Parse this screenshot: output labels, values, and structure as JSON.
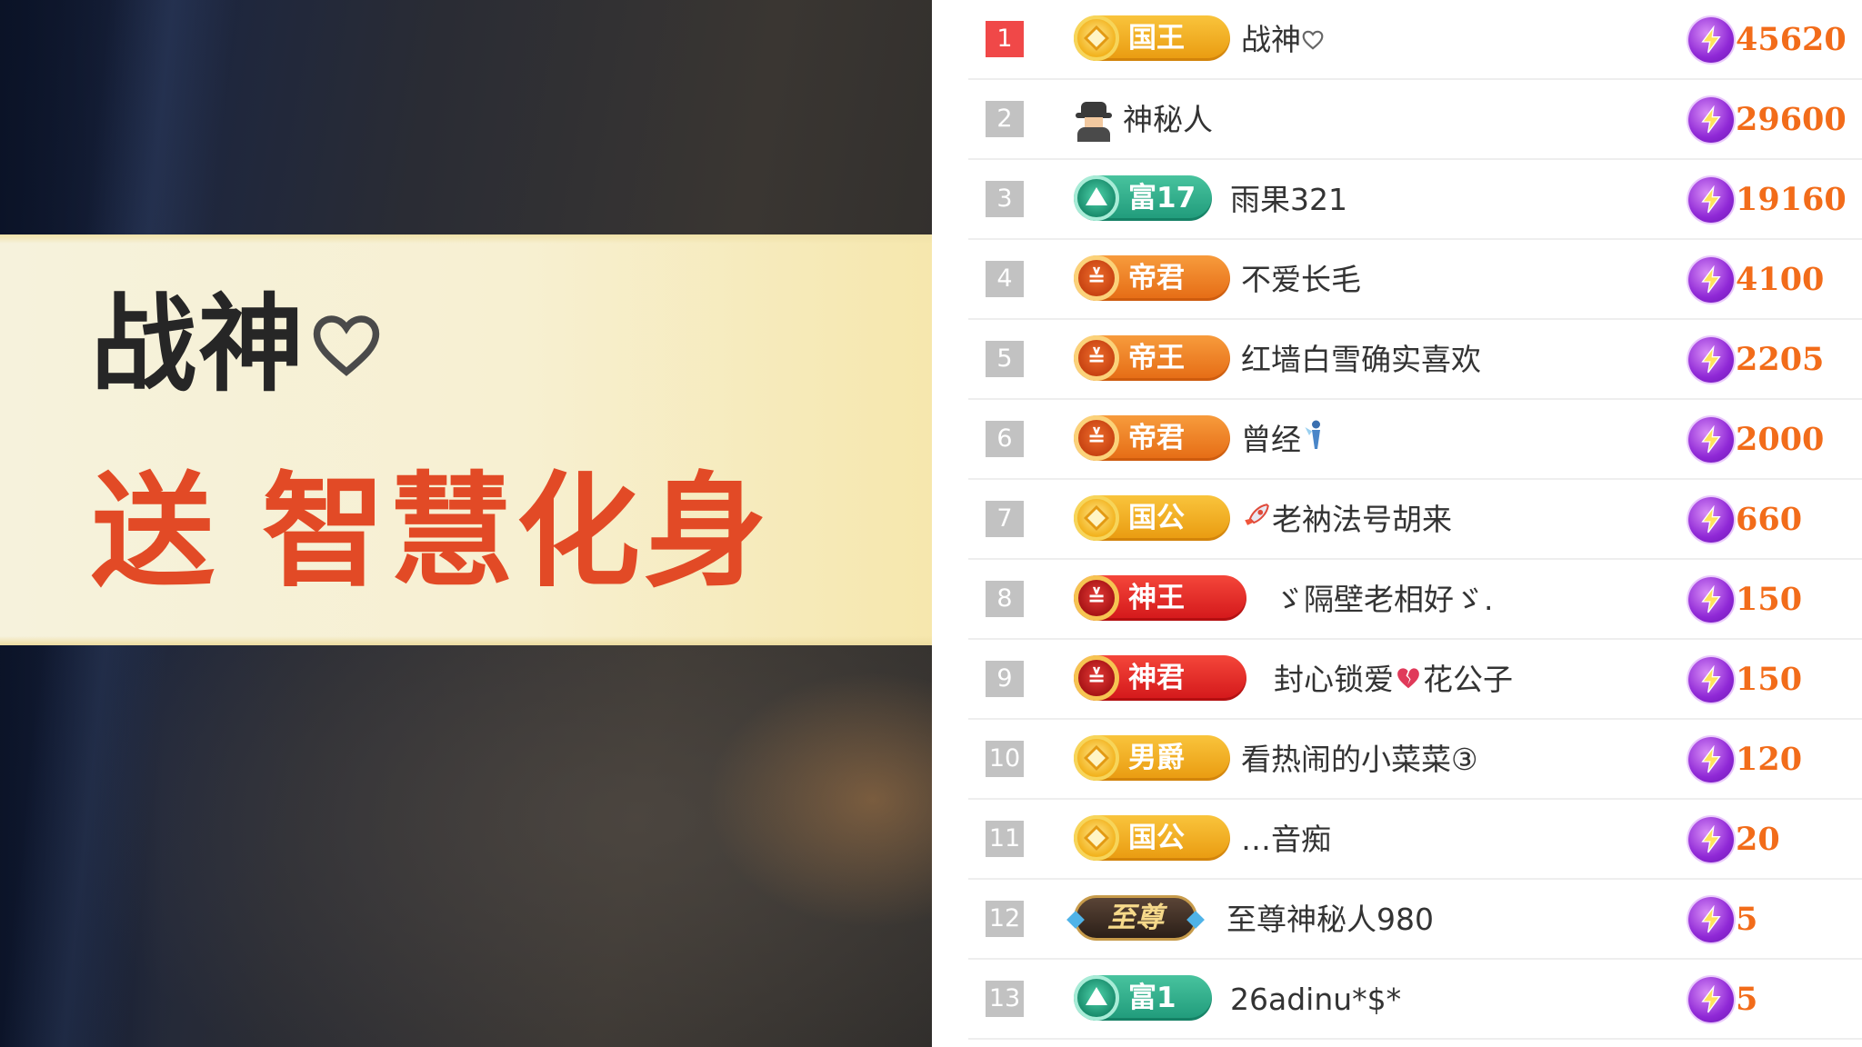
{
  "live_notification": {
    "sender_name": "战神",
    "action": "送",
    "gift_name": "智慧化身"
  },
  "leaderboard": {
    "rows": [
      {
        "rank": "1",
        "badge_style": "gold",
        "badge_text": "国王",
        "username": "战神",
        "score": "45620"
      },
      {
        "rank": "2",
        "badge_style": "spy",
        "badge_text": "",
        "username": "神秘人",
        "score": "29600"
      },
      {
        "rank": "3",
        "badge_style": "teal",
        "badge_text": "富17",
        "username": "雨果321",
        "score": "19160"
      },
      {
        "rank": "4",
        "badge_style": "orange",
        "badge_text": "帝君",
        "username": "不爱长毛",
        "score": "4100"
      },
      {
        "rank": "5",
        "badge_style": "orange",
        "badge_text": "帝王",
        "username": "红墙白雪确实喜欢",
        "score": "2205"
      },
      {
        "rank": "6",
        "badge_style": "orange",
        "badge_text": "帝君",
        "username": "曾经",
        "score": "2000"
      },
      {
        "rank": "7",
        "badge_style": "gold",
        "badge_text": "国公",
        "username": "老衲法号胡来",
        "score": "660"
      },
      {
        "rank": "8",
        "badge_style": "red",
        "badge_text": "神王",
        "username": "ゞ隔壁老相好ゞ.",
        "score": "150"
      },
      {
        "rank": "9",
        "badge_style": "red",
        "badge_text": "神君",
        "username": "封心锁爱",
        "username_suffix": "花公子",
        "score": "150"
      },
      {
        "rank": "10",
        "badge_style": "gold",
        "badge_text": "男爵",
        "username": "看热闹的小菜菜③",
        "score": "120"
      },
      {
        "rank": "11",
        "badge_style": "gold",
        "badge_text": "国公",
        "username": "…音痴",
        "score": "20"
      },
      {
        "rank": "12",
        "badge_style": "dark",
        "badge_text": "至尊",
        "username": "至尊神秘人980",
        "score": "5"
      },
      {
        "rank": "13",
        "badge_style": "teal",
        "badge_text": "富1",
        "username": "26adinu*$*",
        "score": "5"
      }
    ]
  },
  "colors": {
    "rank_first": "#f04848",
    "rank_other": "#c2c2c2",
    "score_text": "#f26c1a",
    "gift_text": "#e24a26",
    "banner_bg": "#f6f2dc"
  },
  "icons": {
    "heart": "heart-outline-icon",
    "score": "lightning-bolt-icon",
    "spy": "spy-avatar-icon"
  }
}
